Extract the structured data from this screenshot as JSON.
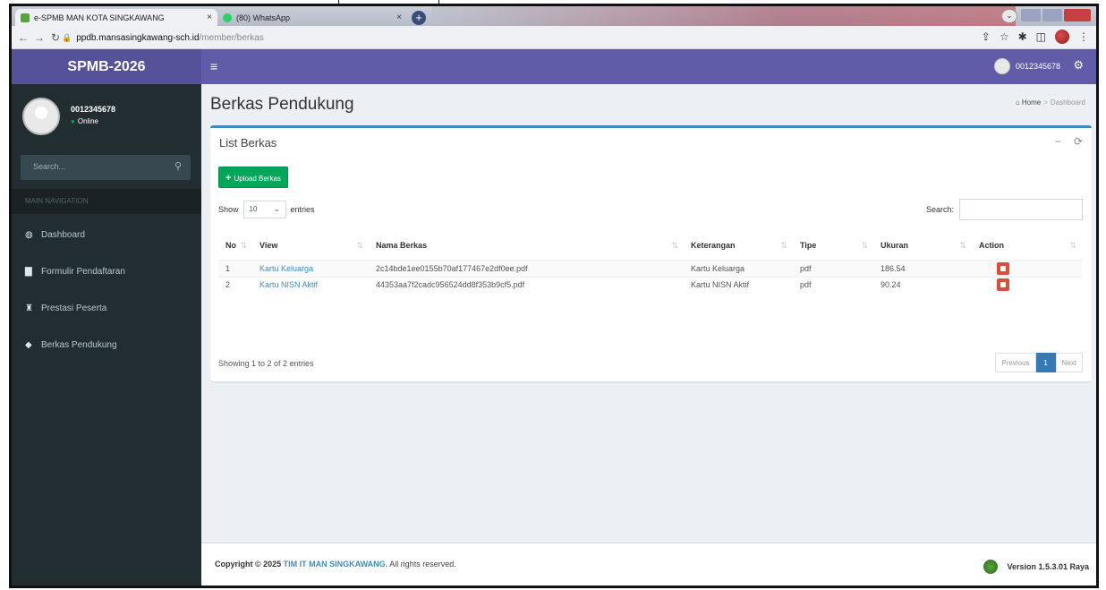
{
  "browser": {
    "tabs": [
      {
        "title": "e-SPMB MAN KOTA SINGKAWANG",
        "active": true
      },
      {
        "title": "(80) WhatsApp",
        "active": false
      }
    ],
    "url_host": "ppdb.mansasingkawang-sch.id",
    "url_path": "/member/berkas"
  },
  "header": {
    "brand": "SPMB-2026",
    "username": "0012345678"
  },
  "sidebar": {
    "username": "0012345678",
    "status": "Online",
    "search_placeholder": "Search...",
    "section_header": "MAIN NAVIGATION",
    "items": [
      {
        "label": "Dashboard",
        "icon": "dashboard-icon"
      },
      {
        "label": "Formulir Pendaftaran",
        "icon": "file-icon"
      },
      {
        "label": "Prestasi Peserta",
        "icon": "trophy-icon"
      },
      {
        "label": "Berkas Pendukung",
        "icon": "folder-icon"
      }
    ]
  },
  "page": {
    "title": "Berkas Pendukung",
    "breadcrumb_home": "Home",
    "breadcrumb_current": "Dashboard"
  },
  "box": {
    "title": "List Berkas",
    "upload_label": "Upload Berkas",
    "show_label": "Show",
    "entries_value": "10",
    "entries_label": "entries",
    "search_label": "Search:",
    "columns": [
      "No",
      "View",
      "Nama Berkas",
      "Keterangan",
      "Tipe",
      "Ukuran",
      "Action"
    ],
    "rows": [
      {
        "no": "1",
        "view": "Kartu Keluarga",
        "nama": "2c14bde1ee0155b70af177467e2df0ee.pdf",
        "keterangan": "Kartu Keluarga",
        "tipe": "pdf",
        "ukuran": "186.54"
      },
      {
        "no": "2",
        "view": "Kartu NISN Aktif",
        "nama": "44353aa7f2cadc956524dd8f353b9cf5.pdf",
        "keterangan": "Kartu NISN Aktif",
        "tipe": "pdf",
        "ukuran": "90.24"
      }
    ],
    "info": "Showing 1 to 2 of 2 entries",
    "pager": {
      "previous": "Previous",
      "current": "1",
      "next": "Next"
    }
  },
  "footer": {
    "copyright_prefix": "Copyright © 2025",
    "org": "TIM IT MAN SINGKAWANG.",
    "rights": "All rights reserved.",
    "version": "Version 1.5.3.01 Raya"
  },
  "colors": {
    "header": "#605ca8",
    "brand_bg": "#555299",
    "sidebar": "#222d32",
    "success": "#00a65a",
    "danger": "#dd4b39",
    "primary": "#3c8dbc"
  }
}
